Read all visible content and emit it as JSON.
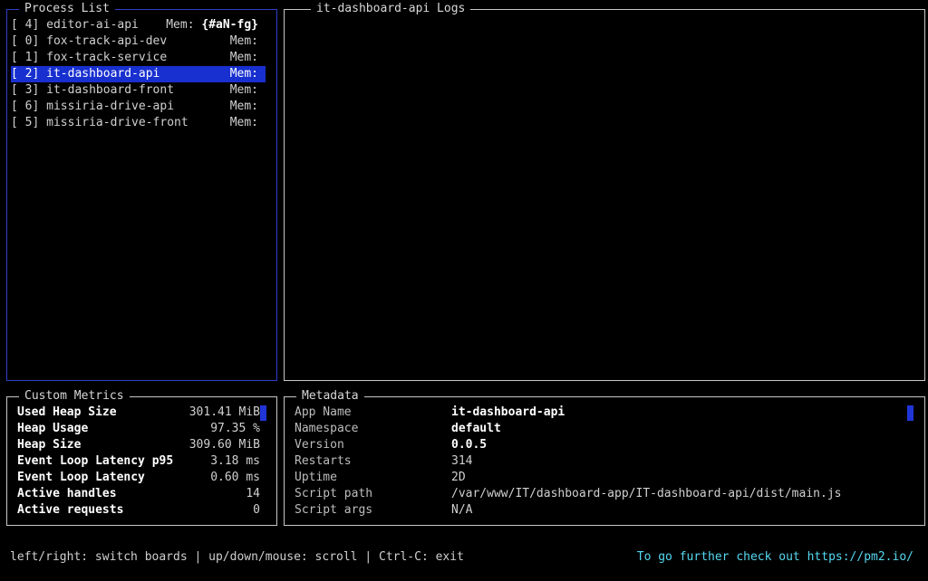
{
  "process_list": {
    "title": "Process List",
    "items": [
      {
        "id": "[ 4]",
        "name": "editor-ai-api",
        "mem_label": "Mem:",
        "mem_value": "{#aN-fg}",
        "selected": false
      },
      {
        "id": "[ 0]",
        "name": "fox-track-api-dev",
        "mem_label": "Mem:",
        "mem_value": "",
        "selected": false
      },
      {
        "id": "[ 1]",
        "name": "fox-track-service",
        "mem_label": "Mem:",
        "mem_value": "",
        "selected": false
      },
      {
        "id": "[ 2]",
        "name": "it-dashboard-api",
        "mem_label": "Mem:",
        "mem_value": "",
        "selected": true
      },
      {
        "id": "[ 3]",
        "name": "it-dashboard-front",
        "mem_label": "Mem:",
        "mem_value": "",
        "selected": false
      },
      {
        "id": "[ 6]",
        "name": "missiria-drive-api",
        "mem_label": "Mem:",
        "mem_value": "",
        "selected": false
      },
      {
        "id": "[ 5]",
        "name": "missiria-drive-front",
        "mem_label": "Mem:",
        "mem_value": "",
        "selected": false
      }
    ]
  },
  "logs": {
    "title": "it-dashboard-api Logs"
  },
  "custom_metrics": {
    "title": "Custom Metrics",
    "items": [
      {
        "label": "Used Heap Size",
        "value": "301.41 MiB"
      },
      {
        "label": "Heap Usage",
        "value": "97.35 %"
      },
      {
        "label": "Heap Size",
        "value": "309.60 MiB"
      },
      {
        "label": "Event Loop Latency p95",
        "value": "3.18 ms"
      },
      {
        "label": "Event Loop Latency",
        "value": "0.60 ms"
      },
      {
        "label": "Active handles",
        "value": "14"
      },
      {
        "label": "Active requests",
        "value": "0"
      }
    ]
  },
  "metadata": {
    "title": "Metadata",
    "items": [
      {
        "label": "App Name",
        "value": "it-dashboard-api",
        "bold": true
      },
      {
        "label": "Namespace",
        "value": "default",
        "bold": true
      },
      {
        "label": "Version",
        "value": "0.0.5",
        "bold": true
      },
      {
        "label": "Restarts",
        "value": "314",
        "bold": false
      },
      {
        "label": "Uptime",
        "value": "2D",
        "bold": false
      },
      {
        "label": "Script path",
        "value": "/var/www/IT/dashboard-app/IT-dashboard-api/dist/main.js",
        "bold": false
      },
      {
        "label": "Script args",
        "value": "N/A",
        "bold": false
      }
    ]
  },
  "footer": {
    "help": "left/right: switch boards | up/down/mouse: scroll | Ctrl-C: exit",
    "link_text": "To go further check out https://pm2.io/"
  },
  "colors": {
    "selection": "#1830d0",
    "active_border": "#2f3fc8",
    "link": "#56d8f0"
  }
}
